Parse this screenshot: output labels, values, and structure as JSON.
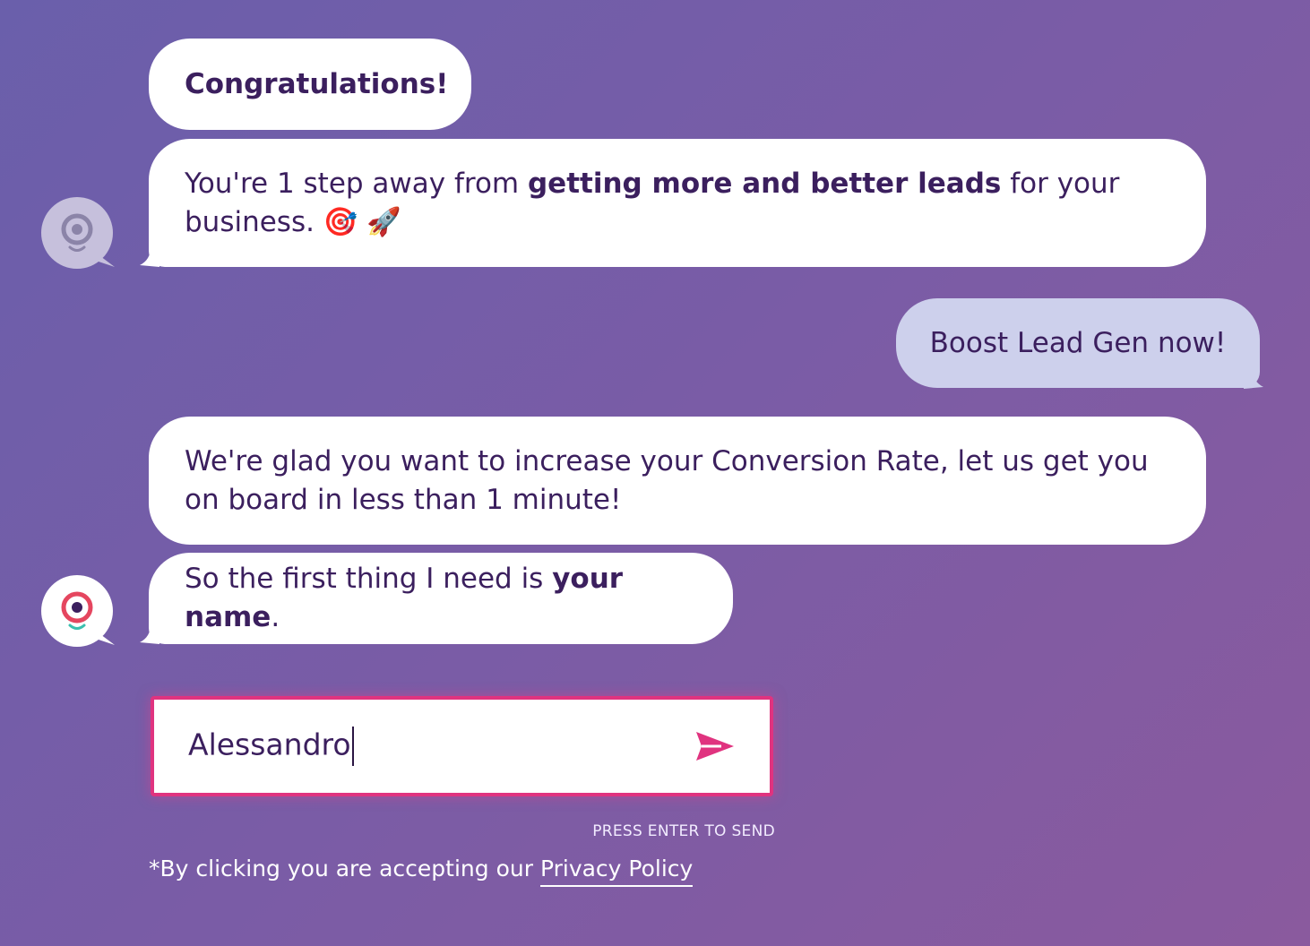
{
  "messages": {
    "m1": {
      "bold": "Congratulations!"
    },
    "m2": {
      "pre": "You're 1 step away from ",
      "bold": "getting more and better leads",
      "post": " for your business. 🎯 🚀"
    },
    "m3": {
      "text": "We're glad you want to increase your Conversion Rate, let us get you on board in less than 1 minute!"
    },
    "m4": {
      "pre": "So the first thing I need is ",
      "bold": "your name",
      "post": "."
    }
  },
  "user_reply": "Boost Lead Gen now!",
  "input": {
    "value": "Alessandro"
  },
  "hint": "PRESS ENTER TO SEND",
  "consent": {
    "text": "*By clicking you are accepting our ",
    "link": "Privacy Policy"
  },
  "colors": {
    "accent": "#e0337f",
    "user_bubble": "#cdd0ec",
    "text": "#3b1f5e"
  },
  "icons": {
    "send": "send-icon",
    "bot": "bot-avatar-icon"
  }
}
